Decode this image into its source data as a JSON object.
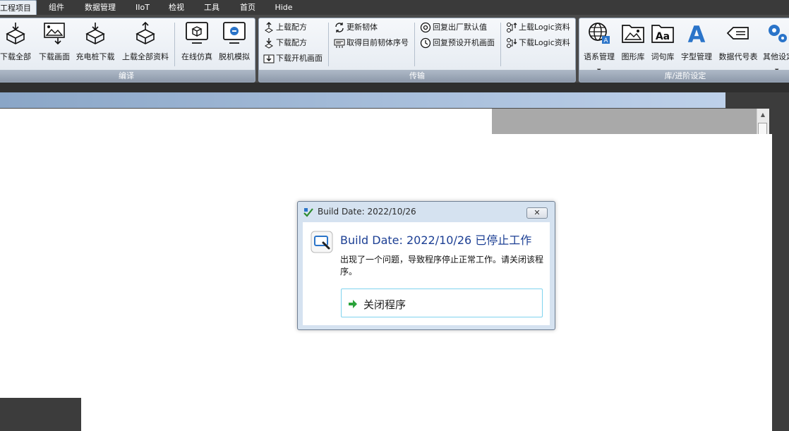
{
  "menu": {
    "tabs": [
      "工程项目",
      "组件",
      "数据管理",
      "IIoT",
      "检视",
      "工具",
      "首页",
      "Hide"
    ],
    "active": "工程项目"
  },
  "ribbon": {
    "compile": {
      "label": "编译",
      "buttons": [
        "下载全部",
        "下载画面",
        "充电桩下载",
        "上载全部资料",
        "在线仿真",
        "脱机模拟"
      ]
    },
    "transfer": {
      "label": "传输",
      "col1": [
        "上载配方",
        "下载配方",
        "下载开机画面"
      ],
      "col2": [
        "更新韧体",
        "取得目前韧体序号"
      ],
      "col3": [
        "回复出厂默认值",
        "回复预设开机画面"
      ],
      "col4": [
        "上载Logic资料",
        "下载Logic资料"
      ]
    },
    "library": {
      "label": "库/进阶设定",
      "buttons": [
        "语系管理",
        "图形库",
        "词句库",
        "字型管理",
        "数据代号表",
        "其他设定"
      ]
    }
  },
  "dialog": {
    "title": "Build Date: 2022/10/26",
    "heading": "Build Date: 2022/10/26 已停止工作",
    "message": "出现了一个问题，导致程序停止正常工作。请关闭该程序。",
    "action": "关闭程序",
    "close_glyph": "✕"
  },
  "colors": {
    "heading": "#1c3f94",
    "action_border": "#7fd3ee",
    "ribbon_label_bg": "#8e9aab"
  }
}
